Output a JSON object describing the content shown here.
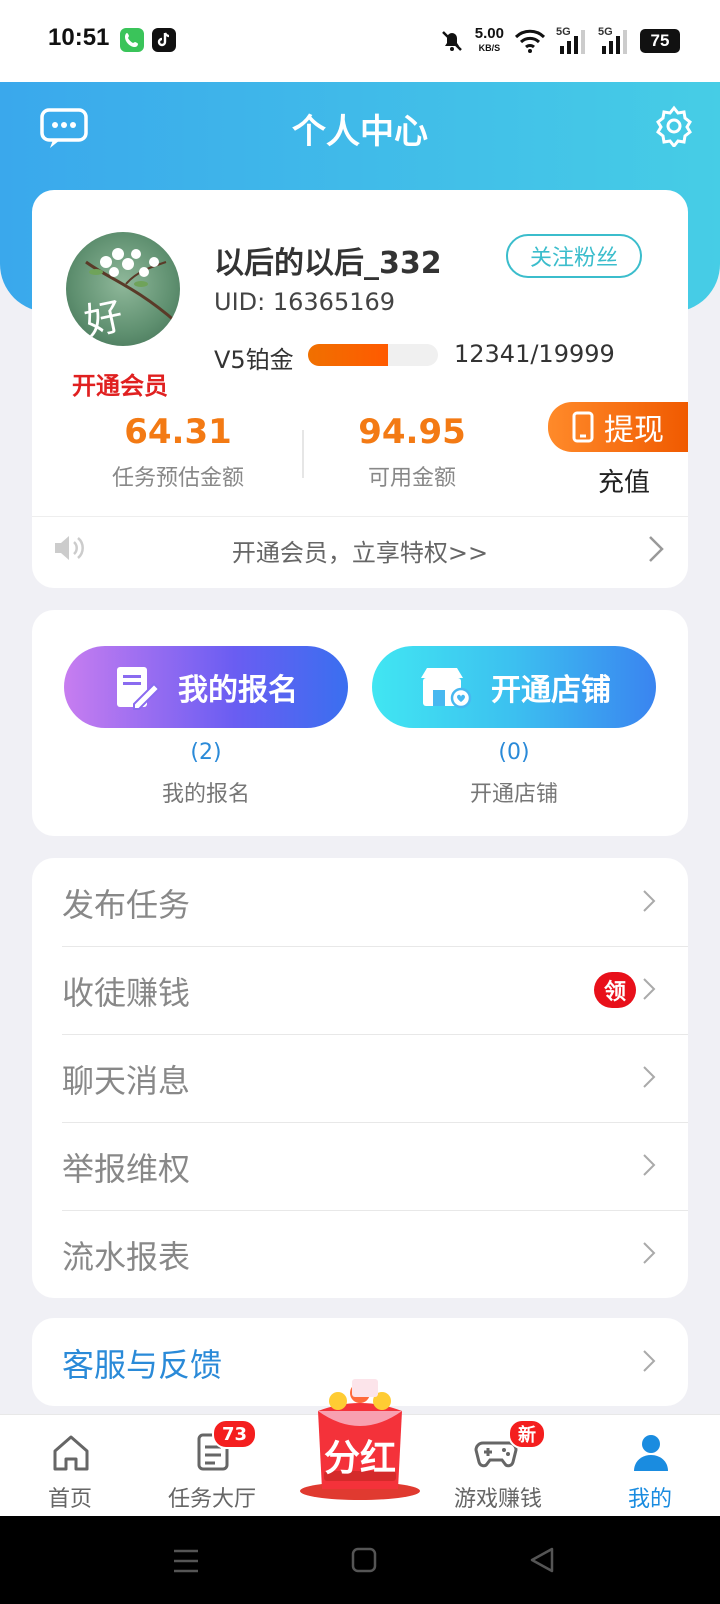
{
  "status": {
    "time": "10:51",
    "net_speed": "5.00",
    "net_unit": "KB/S",
    "battery": "75",
    "signal1": "5G",
    "signal2": "5G"
  },
  "header": {
    "title": "个人中心",
    "chat_icon": "chat-icon",
    "settings_icon": "gear-icon"
  },
  "profile": {
    "username": "以后的以后_332",
    "uid_label": "UID:",
    "uid": "16365169",
    "follow_label": "关注粉丝",
    "vip_link": "开通会员",
    "avatar_char": "好",
    "level": "V5铂金",
    "level_progress": 0.617,
    "level_value": "12341/19999",
    "task_amount": "64.31",
    "task_amount_label": "任务预估金额",
    "available_amount": "94.95",
    "available_amount_label": "可用金额",
    "withdraw_label": "提现",
    "recharge_label": "充值",
    "notice": "开通会员，立享特权>>"
  },
  "actions": {
    "signup": {
      "label": "我的报名",
      "count": "(2)",
      "name": "我的报名"
    },
    "shop": {
      "label": "开通店铺",
      "count": "(0)",
      "name": "开通店铺"
    }
  },
  "menu": [
    {
      "label": "发布任务"
    },
    {
      "label": "收徒赚钱",
      "badge": "领"
    },
    {
      "label": "聊天消息"
    },
    {
      "label": "举报维权"
    },
    {
      "label": "流水报表"
    }
  ],
  "support": {
    "label": "客服与反馈"
  },
  "tabs": [
    {
      "label": "首页"
    },
    {
      "label": "任务大厅",
      "badge": "73"
    },
    {
      "label": "分红"
    },
    {
      "label": "游戏赚钱",
      "badge": "新"
    },
    {
      "label": "我的"
    }
  ],
  "colors": {
    "accent": "#2a8ad8",
    "orange": "#f37a14",
    "red": "#e02020",
    "header_start": "#3aa8ec",
    "header_end": "#46cde6"
  }
}
